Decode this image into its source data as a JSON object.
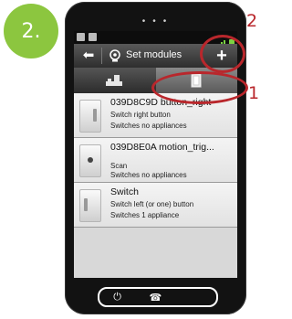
{
  "badge": {
    "step_label": "2."
  },
  "screen": {
    "title": "Set modules",
    "back_icon": "arrow-left-icon",
    "add_symbol": "+",
    "tabs": [
      {
        "icon": "room-icon",
        "active": false
      },
      {
        "icon": "module-icon",
        "active": true
      }
    ]
  },
  "modules": [
    {
      "name": "039D8C9D button_right",
      "line1": "Switch right button",
      "line2": "Switches no appliances"
    },
    {
      "name": "039D8E0A motion_trig...",
      "line1": "Scan",
      "line2": "Switches no appliances"
    },
    {
      "name": "Switch",
      "line1": "Switch left (or one) button",
      "line2": "Switches 1 appliance"
    }
  ],
  "hardware": {
    "power_glyph": "⏻",
    "phone_glyph": "☎"
  },
  "callouts": {
    "tabs_number": "1",
    "add_number": "2"
  },
  "colors": {
    "badge": "#8cc63f",
    "callout": "#b9272c",
    "signal": "#7bd342"
  }
}
